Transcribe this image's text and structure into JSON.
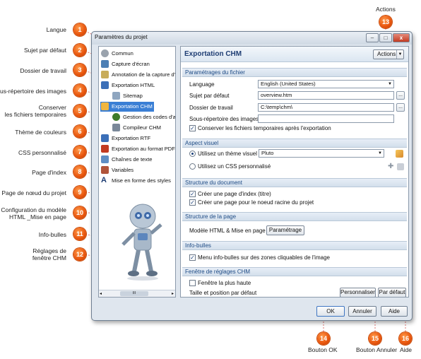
{
  "annotations": {
    "top_label": "Actions",
    "left": [
      {
        "num": "1",
        "label": "Langue"
      },
      {
        "num": "2",
        "label": "Sujet par défaut"
      },
      {
        "num": "3",
        "label": "Dossier de travail"
      },
      {
        "num": "4",
        "label": "Sous-répertoire des images"
      },
      {
        "num": "5",
        "label_line1": "Conserver",
        "label_line2": "les fichiers temporaires"
      },
      {
        "num": "6",
        "label": "Thème de couleurs"
      },
      {
        "num": "7",
        "label": "CSS personnalisé"
      },
      {
        "num": "8",
        "label": "Page d'index"
      },
      {
        "num": "9",
        "label": "Page de nœud du projet"
      },
      {
        "num": "10",
        "label_line1": "Configuration du modèle",
        "label_line2": "HTML _Mise en page"
      },
      {
        "num": "11",
        "label": "Info-bulles"
      },
      {
        "num": "12",
        "label_line1": "Réglages de",
        "label_line2": "fenêtre CHM"
      }
    ],
    "top": {
      "num": "13"
    },
    "bottom": [
      {
        "num": "14",
        "label": "Bouton OK"
      },
      {
        "num": "15",
        "label": "Bouton Annuler"
      },
      {
        "num": "16",
        "label": "Aide"
      }
    ],
    "colors": {
      "badge": "#e8540c",
      "leader": "#d9534f"
    }
  },
  "window": {
    "title": "Paramètres du projet",
    "controls": {
      "minimize": "–",
      "maximize": "□",
      "close": "x"
    }
  },
  "tree": {
    "items": [
      {
        "label": "Commun",
        "icon": "gear-icon"
      },
      {
        "label": "Capture d'écran",
        "icon": "screenshot-icon"
      },
      {
        "label": "Annotation de la capture d'écr",
        "icon": "annotation-icon"
      },
      {
        "label": "Exportation HTML",
        "icon": "html-export-icon"
      },
      {
        "label": "Sitemap",
        "icon": "sitemap-icon"
      },
      {
        "label": "Exportation CHM",
        "icon": "chm-export-icon"
      },
      {
        "label": "Gestion des codes d'aide",
        "icon": "help-codes-icon"
      },
      {
        "label": "Compileur CHM",
        "icon": "compiler-icon"
      },
      {
        "label": "Exportation RTF",
        "icon": "rtf-export-icon"
      },
      {
        "label": "Exportation au format PDF",
        "icon": "pdf-export-icon"
      },
      {
        "label": "Chaînes de texte",
        "icon": "strings-icon"
      },
      {
        "label": "Variables",
        "icon": "variables-icon"
      },
      {
        "label": "Mise en forme des styles",
        "icon": "styles-icon"
      }
    ],
    "scroll_glyph": "III"
  },
  "pane": {
    "title": "Exportation CHM",
    "actions_label": "Actions",
    "sections": {
      "file_settings": "Paramétrages du fichier",
      "appearance": "Aspect visuel",
      "doc_structure": "Structure du document",
      "page_structure": "Structure de la page",
      "tooltips": "Info-bulles",
      "chm_window": "Fenêtre de réglages CHM"
    },
    "fields": {
      "language_label": "Language",
      "language_value": "English (United States)",
      "topic_label": "Sujet par défaut",
      "topic_value": "overview.htm",
      "workdir_label": "Dossier de travail",
      "workdir_value": "C:\\temp\\chm\\",
      "images_label": "Sous-répertoire des images",
      "images_value": "",
      "keep_temp_label": "Conserver les fichiers temporaires après l'exportation",
      "use_theme_label": "Utilisez un thème visuel",
      "theme_value": "Pluto",
      "use_css_label": "Utilisez un CSS personnalisé",
      "index_page_label": "Créer une page d'index (titre)",
      "root_page_label": "Créer une page pour le noeud racine du projet",
      "template_label": "Modèle HTML & Mise en page",
      "template_button": "Paramétrage",
      "tooltips_label": "Menu info-bulles sur des zones cliquables de l'image",
      "top_window_label": "Fenêtre la plus haute",
      "size_pos_label": "Taille et position par défaut",
      "customize_button": "Personnaliser",
      "default_button": "Par défaut",
      "browse_glyph": "..."
    },
    "state": {
      "keep_temp": true,
      "use_theme": true,
      "use_css": false,
      "index_page": true,
      "root_page": true,
      "tooltips": true,
      "top_window": false
    }
  },
  "dialog_buttons": {
    "ok": "OK",
    "cancel": "Annuler",
    "help": "Aide"
  }
}
